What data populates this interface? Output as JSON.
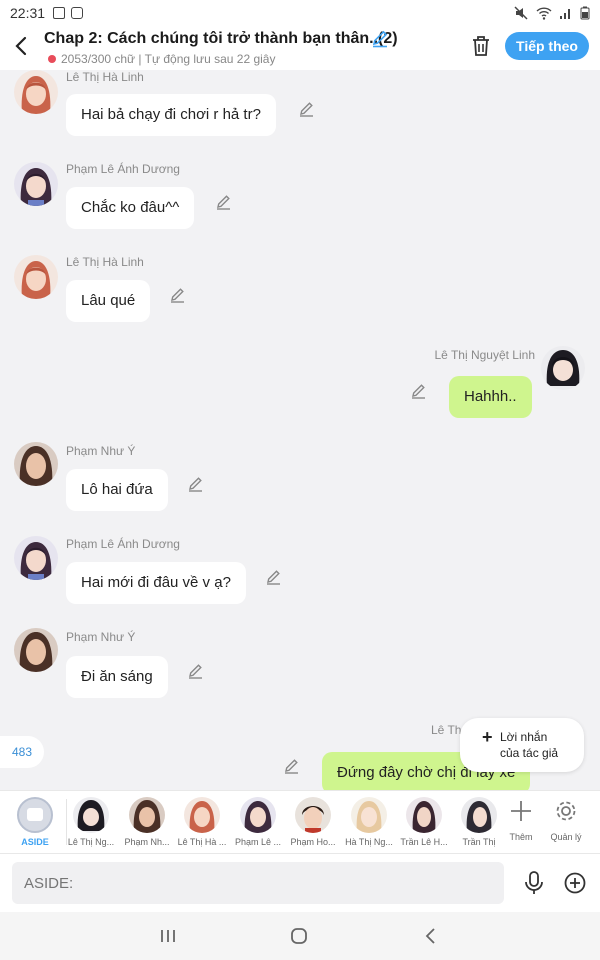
{
  "status": {
    "time": "22:31"
  },
  "header": {
    "title": "Chap 2: Cách chúng tôi trở thành bạn thân..(2)",
    "subtitle": "2053/300 chữ | Tự động lưu sau 22 giây",
    "next_label": "Tiếp theo"
  },
  "messages": [
    {
      "name": "Lê Thị Hà Linh",
      "text": "Hai bả chạy đi chơi r hả tr?",
      "side": "left"
    },
    {
      "name": "Phạm Lê Ánh Dương",
      "text": "Chắc ko đâu^^",
      "side": "left"
    },
    {
      "name": "Lê Thị Hà Linh",
      "text": "Lâu qué",
      "side": "left"
    },
    {
      "name": "Lê Thị Nguyệt Linh",
      "text": "Hahhh..",
      "side": "right"
    },
    {
      "name": "Phạm Như Ý",
      "text": "Lô hai đứa",
      "side": "left"
    },
    {
      "name": "Phạm Lê Ánh Dương",
      "text": "Hai mới đi đâu về v ạ?",
      "side": "left"
    },
    {
      "name": "Phạm Như Ý",
      "text": "Đi ăn sáng",
      "side": "left"
    },
    {
      "name": "Lê Th",
      "text": "Đứng đây chờ chị đi lấy xe",
      "side": "right"
    }
  ],
  "counter": "483",
  "author_note": {
    "line1": "Lời nhắn",
    "line2": "của tác giả"
  },
  "characters": [
    {
      "label": "ASIDE"
    },
    {
      "label": "Lê Thị Ng..."
    },
    {
      "label": "Phạm Nh..."
    },
    {
      "label": "Lê Thị Hà ..."
    },
    {
      "label": "Phạm Lê ..."
    },
    {
      "label": "Phạm Ho..."
    },
    {
      "label": "Hà Thị Ng..."
    },
    {
      "label": "Trần Lê H..."
    },
    {
      "label": "Trần Thị"
    },
    {
      "label": "Thêm"
    },
    {
      "label": "Quản lý"
    }
  ],
  "input": {
    "placeholder": "ASIDE:"
  },
  "colors": {
    "accent": "#3ea2f2",
    "my_bubble": "#cff58e",
    "background": "#f2f2f4"
  }
}
